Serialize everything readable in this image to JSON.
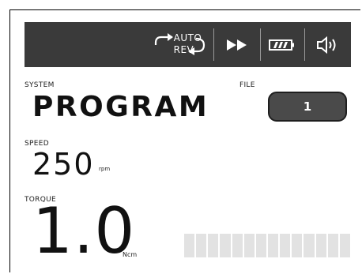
{
  "toolbar": {
    "auto_line1": "AUTO",
    "auto_line2": "REV",
    "icons": [
      "auto-reverse-icon",
      "fast-forward-icon",
      "battery-icon",
      "speaker-volume-icon"
    ]
  },
  "system": {
    "label": "SYSTEM",
    "value": "PROGRAM"
  },
  "file": {
    "label": "FILE",
    "value": "1"
  },
  "speed": {
    "label": "SPEED",
    "value": "250",
    "unit": "rpm"
  },
  "torque": {
    "label": "TORQUE",
    "value": "1.0",
    "unit": "Ncm"
  },
  "torque_gauge": {
    "segments": 14,
    "level": 0
  },
  "colors": {
    "bar": "#3a3a3a",
    "gauge_off": "#e2e2e2",
    "text": "#111111"
  }
}
